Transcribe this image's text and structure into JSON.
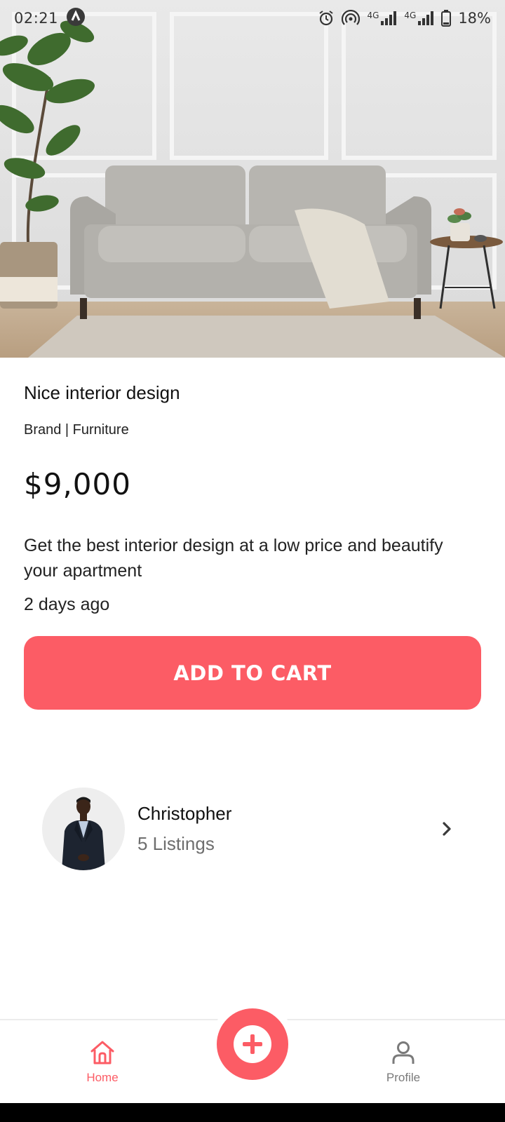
{
  "status_bar": {
    "time": "02:21",
    "battery": "18%",
    "network_1": "4G",
    "network_2": "4G"
  },
  "product": {
    "title": "Nice interior design",
    "subtitle": "Brand | Furniture",
    "price": "$9,000",
    "description": "Get the best interior design at a low price and beautify your apartment",
    "posted": "2 days ago",
    "add_to_cart_label": "ADD TO CART"
  },
  "seller": {
    "name": "Christopher",
    "listings": "5 Listings"
  },
  "bottom_nav": {
    "home_label": "Home",
    "profile_label": "Profile"
  },
  "colors": {
    "accent": "#fc5c65",
    "text": "#111111",
    "muted": "#6e6e6e"
  },
  "icons": {
    "home": "home-icon",
    "profile": "profile-icon",
    "add": "plus-icon",
    "chevron": "chevron-right-icon"
  }
}
